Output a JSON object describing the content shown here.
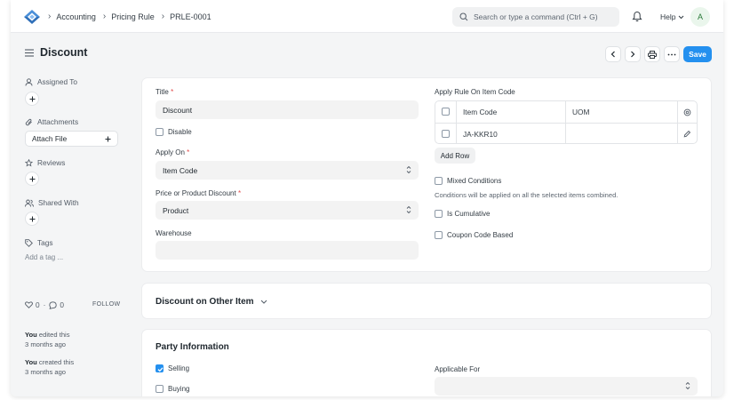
{
  "navbar": {
    "breadcrumbs": [
      "Accounting",
      "Pricing Rule",
      "PRLE-0001"
    ],
    "search_placeholder": "Search or type a command (Ctrl + G)",
    "help_label": "Help",
    "avatar_initial": "A"
  },
  "page": {
    "title": "Discount",
    "save_label": "Save"
  },
  "sidebar": {
    "assigned_to": "Assigned To",
    "attachments": "Attachments",
    "attach_file": "Attach File",
    "reviews": "Reviews",
    "shared_with": "Shared With",
    "tags": "Tags",
    "add_tag": "Add a tag ...",
    "likes_count": "0",
    "comments_count": "0",
    "follow": "FOLLOW",
    "activity": [
      {
        "who": "You",
        "what": "edited this",
        "when": "3 months ago"
      },
      {
        "who": "You",
        "what": "created this",
        "when": "3 months ago"
      }
    ]
  },
  "form": {
    "title_label": "Title",
    "title_value": "Discount",
    "disable_label": "Disable",
    "disable_checked": false,
    "apply_on_label": "Apply On",
    "apply_on_value": "Item Code",
    "price_or_product_label": "Price or Product Discount",
    "price_or_product_value": "Product",
    "warehouse_label": "Warehouse",
    "warehouse_value": "",
    "apply_rule_label": "Apply Rule On Item Code",
    "grid": {
      "columns": [
        "Item Code",
        "UOM"
      ],
      "rows": [
        [
          "JA-KKR10",
          ""
        ]
      ]
    },
    "add_row": "Add Row",
    "mixed_conditions": "Mixed Conditions",
    "mixed_hint": "Conditions will be applied on all the selected items combined.",
    "is_cumulative": "Is Cumulative",
    "coupon_code_based": "Coupon Code Based"
  },
  "sections": {
    "discount_other_item": "Discount on Other Item",
    "party_information": "Party Information"
  },
  "party": {
    "selling_label": "Selling",
    "selling_checked": true,
    "buying_label": "Buying",
    "buying_checked": false,
    "applicable_for_label": "Applicable For",
    "applicable_for_value": ""
  },
  "colors": {
    "primary": "#2490ef",
    "background": "#f4f5f6",
    "input_bg": "#f3f3f3"
  }
}
